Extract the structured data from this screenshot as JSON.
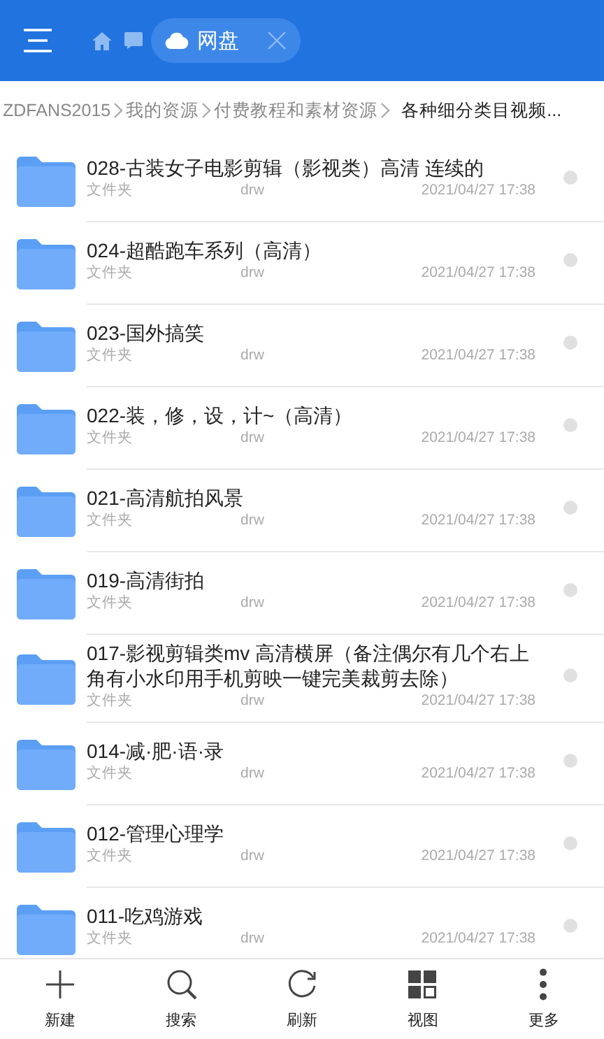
{
  "header": {
    "tab": {
      "label": "网盘"
    }
  },
  "breadcrumb": [
    "ZDFANS2015",
    "我的资源",
    "付费教程和素材资源",
    "各种细分类目视频..."
  ],
  "files": [
    {
      "name": "028-古装女子电影剪辑（影视类）高清  连续的",
      "type": "文件夹",
      "perm": "drw",
      "date": "2021/04/27 17:38"
    },
    {
      "name": "024-超酷跑车系列（高清）",
      "type": "文件夹",
      "perm": "drw",
      "date": "2021/04/27 17:38"
    },
    {
      "name": "023-国外搞笑",
      "type": "文件夹",
      "perm": "drw",
      "date": "2021/04/27 17:38"
    },
    {
      "name": "022-装，修，设，计~（高清）",
      "type": "文件夹",
      "perm": "drw",
      "date": "2021/04/27 17:38"
    },
    {
      "name": "021-高清航拍风景",
      "type": "文件夹",
      "perm": "drw",
      "date": "2021/04/27 17:38"
    },
    {
      "name": "019-高清街拍",
      "type": "文件夹",
      "perm": "drw",
      "date": "2021/04/27 17:38"
    },
    {
      "name": "017-影视剪辑类mv  高清横屏（备注偶尔有几个右上角有小水印用手机剪映一键完美裁剪去除）",
      "type": "文件夹",
      "perm": "drw",
      "date": "2021/04/27 17:38"
    },
    {
      "name": "014-减·肥·语·录",
      "type": "文件夹",
      "perm": "drw",
      "date": "2021/04/27 17:38"
    },
    {
      "name": "012-管理心理学",
      "type": "文件夹",
      "perm": "drw",
      "date": "2021/04/27 17:38"
    },
    {
      "name": "011-吃鸡游戏",
      "type": "文件夹",
      "perm": "drw",
      "date": "2021/04/27 17:38"
    }
  ],
  "toolbar": [
    {
      "kind": "plus",
      "label": "新建"
    },
    {
      "kind": "search",
      "label": "搜索"
    },
    {
      "kind": "refresh",
      "label": "刷新"
    },
    {
      "kind": "grid",
      "label": "视图"
    },
    {
      "kind": "more",
      "label": "更多"
    }
  ]
}
